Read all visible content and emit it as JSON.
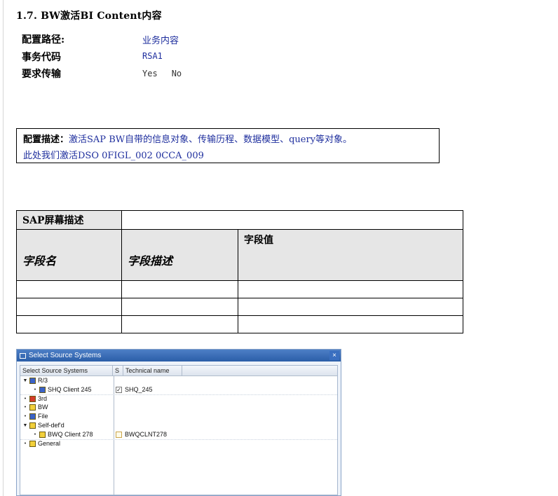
{
  "heading": "1.7. BW激活BI Content内容",
  "meta": {
    "path_label": "配置路径:",
    "path_value": "业务内容",
    "tcode_label": "事务代码",
    "tcode_value": "RSA1",
    "transport_label": "要求传输",
    "transport_yes": "Yes",
    "transport_no": "No"
  },
  "description": {
    "label": "配置描述：",
    "line1": "激活SAP BW自带的信息对象、传输历程、数据模型、query等对象。",
    "line2": "此处我们激活DSO 0FIGL_002  0CCA_009"
  },
  "field_table": {
    "screen_desc_label": "SAP屏幕描述",
    "col_field_name": "字段名",
    "col_field_desc": "字段描述",
    "col_field_value": "字段值"
  },
  "sap_window": {
    "title": "Select Source Systems",
    "close": "×",
    "columns": [
      "Select Source Systems",
      "S",
      "Technical name"
    ],
    "rows": [
      {
        "label": "R/3",
        "expander": "▼",
        "check": "",
        "tech": ""
      },
      {
        "label": "SHQ Client 245",
        "expander": "•",
        "check": "✓",
        "tech": "SHQ_245"
      },
      {
        "label": "3rd",
        "expander": "•",
        "check": "",
        "tech": ""
      },
      {
        "label": "BW",
        "expander": "•",
        "check": "",
        "tech": ""
      },
      {
        "label": "File",
        "expander": "•",
        "check": "",
        "tech": ""
      },
      {
        "label": "Self-def'd",
        "expander": "▼",
        "check": "",
        "tech": ""
      },
      {
        "label": "BWQ Client 278",
        "expander": "•",
        "check": "",
        "tech": "BWQCLNT278"
      },
      {
        "label": "General",
        "expander": "•",
        "check": "",
        "tech": ""
      }
    ],
    "colors": {
      "title_bar": "#2b5ea8",
      "icon_yellow": "#f2d03b",
      "icon_blue": "#3b63c7",
      "icon_red": "#d43b2a"
    }
  }
}
